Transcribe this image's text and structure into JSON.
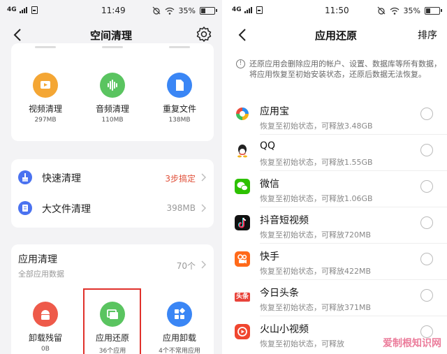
{
  "left": {
    "status": {
      "network": "4G",
      "time": "11:49",
      "battery": "35%"
    },
    "header": {
      "title": "空间清理",
      "back_icon": "chevron-left-icon",
      "settings_icon": "gear-icon"
    },
    "top_tiles": [
      {
        "label": "视频清理",
        "size": "297MB",
        "color": "#f4a634",
        "icon": "video-icon"
      },
      {
        "label": "音频清理",
        "size": "110MB",
        "color": "#5ac460",
        "icon": "audio-icon"
      },
      {
        "label": "重复文件",
        "size": "138MB",
        "color": "#3a86f5",
        "icon": "file-icon"
      }
    ],
    "quick_clean": {
      "label": "快速清理",
      "value": "3步搞定",
      "value_color": "#e0503a"
    },
    "big_files": {
      "label": "大文件清理",
      "value": "398MB"
    },
    "app_clean": {
      "title": "应用清理",
      "subtitle": "全部应用数据",
      "count": "70个",
      "tiles": [
        {
          "label": "卸载残留",
          "sub": "0B",
          "color": "#ee5a4a",
          "icon": "android-icon"
        },
        {
          "label": "应用还原",
          "sub": "36个应用",
          "color": "#5ac460",
          "icon": "restore-icon"
        },
        {
          "label": "应用卸载",
          "sub": "4个不常用应用",
          "color": "#3a86f5",
          "icon": "apps-icon"
        }
      ]
    }
  },
  "right": {
    "status": {
      "network": "4G",
      "time": "11:50",
      "battery": "35%"
    },
    "header": {
      "title": "应用还原",
      "sort_label": "排序",
      "back_icon": "chevron-left-icon"
    },
    "notice": "还原应用会删除应用的帐户、设置、数据库等所有数据，将应用恢复至初始安装状态，还原后数据无法恢复。",
    "apps": [
      {
        "name": "应用宝",
        "detail": "恢复至初始状态，可释放3.48GB",
        "icon": "yingyongbao-icon"
      },
      {
        "name": "QQ",
        "detail": "恢复至初始状态，可释放1.55GB",
        "icon": "qq-icon"
      },
      {
        "name": "微信",
        "detail": "恢复至初始状态，可释放1.06GB",
        "icon": "wechat-icon"
      },
      {
        "name": "抖音短视频",
        "detail": "恢复至初始状态，可释放720MB",
        "icon": "douyin-icon"
      },
      {
        "name": "快手",
        "detail": "恢复至初始状态，可释放422MB",
        "icon": "kuaishou-icon"
      },
      {
        "name": "今日头条",
        "detail": "恢复至初始状态，可释放371MB",
        "icon": "toutiao-icon",
        "icon_text": "头条"
      },
      {
        "name": "火山小视频",
        "detail": "恢复至初始状态，可释放",
        "icon": "huoshan-icon"
      }
    ],
    "watermark": "爱制根知识网"
  },
  "colors": {
    "highlight_box": "#e0312b",
    "accent_blue": "#4a72f0"
  }
}
